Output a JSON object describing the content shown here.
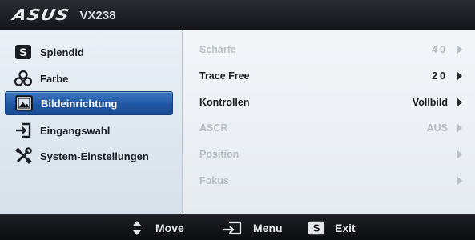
{
  "header": {
    "brand": "ASUS",
    "model": "VX238"
  },
  "menu": {
    "items": [
      {
        "label": "Splendid",
        "icon": "splendid-s-icon"
      },
      {
        "label": "Farbe",
        "icon": "color-dots-icon"
      },
      {
        "label": "Bildeinrichtung",
        "icon": "image-icon"
      },
      {
        "label": "Eingangswahl",
        "icon": "input-enter-icon"
      },
      {
        "label": "System-Einstellungen",
        "icon": "tools-icon"
      }
    ],
    "selected_index": 2
  },
  "settings": {
    "rows": [
      {
        "label": "Schärfe",
        "value": "40",
        "enabled": false
      },
      {
        "label": "Trace Free",
        "value": "20",
        "enabled": true
      },
      {
        "label": "Kontrollen",
        "value": "Vollbild",
        "enabled": true
      },
      {
        "label": "ASCR",
        "value": "AUS",
        "enabled": false
      },
      {
        "label": "Position",
        "value": "",
        "enabled": false
      },
      {
        "label": "Fokus",
        "value": "",
        "enabled": false
      }
    ]
  },
  "footer": {
    "move_label": "Move",
    "menu_label": "Menu",
    "exit_label": "Exit",
    "exit_key": "S"
  },
  "colors": {
    "selection": "#1f56a2",
    "panel_bg": "#e9f0f6",
    "disabled_text": "#b8bec6"
  }
}
